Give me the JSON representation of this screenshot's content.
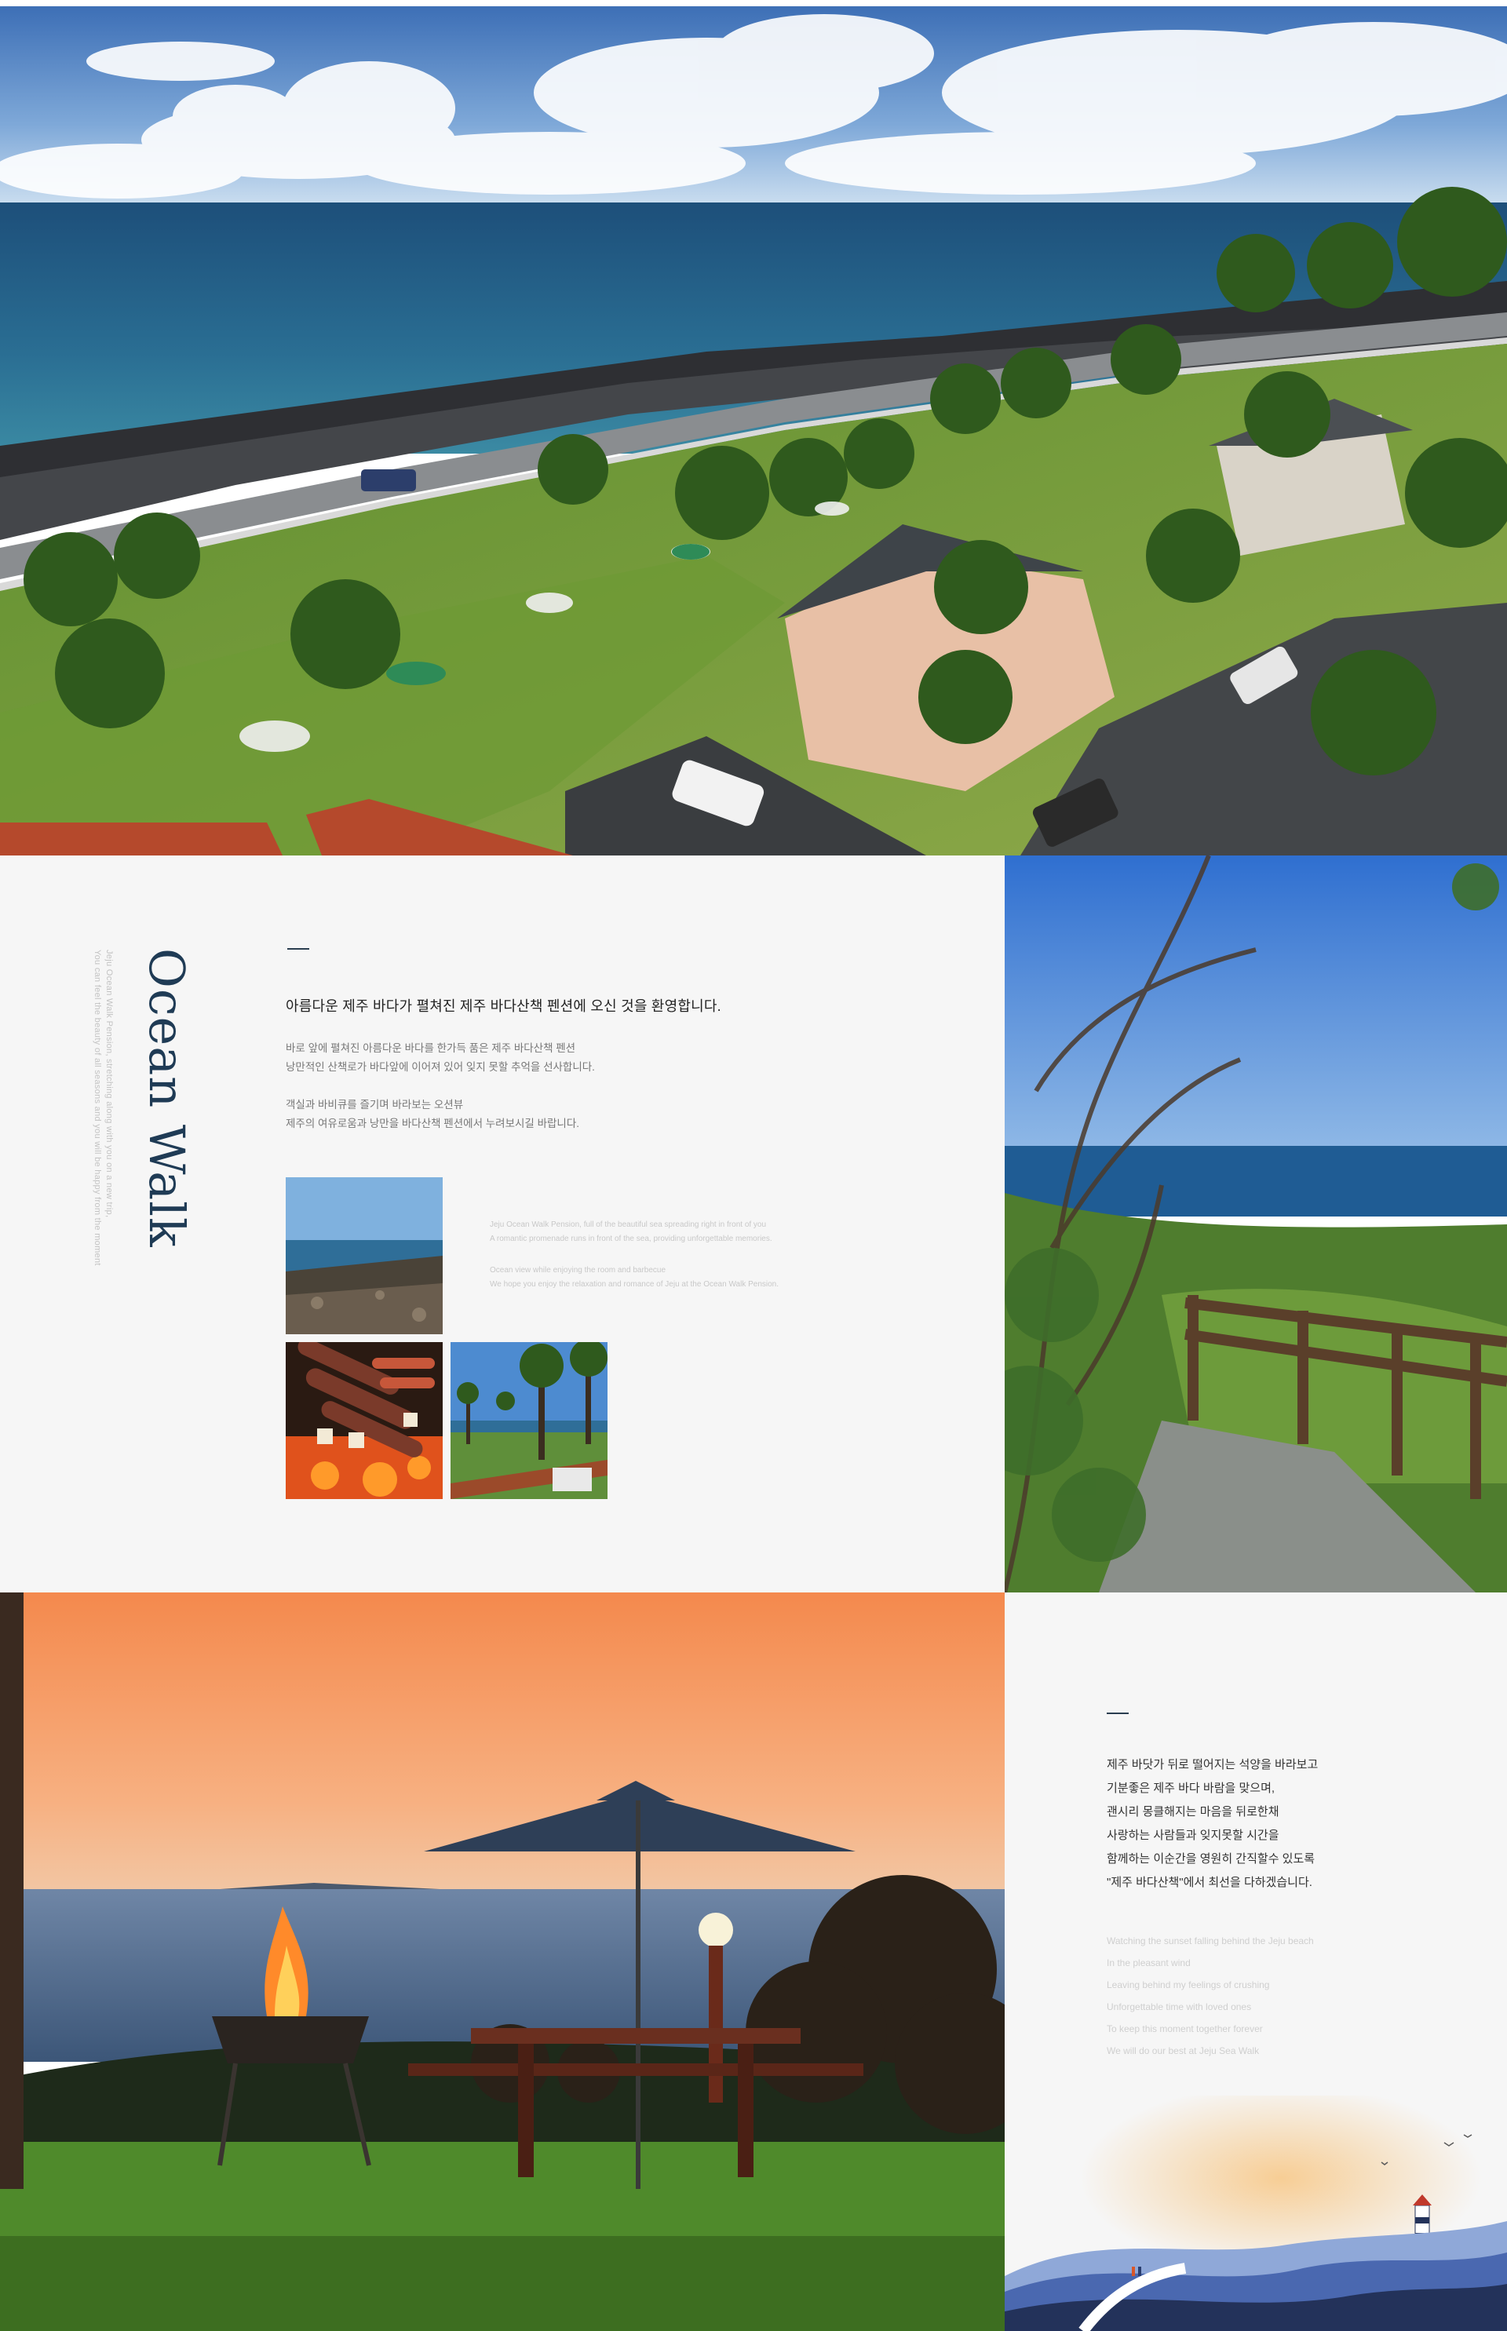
{
  "hero": {
    "image": "aerial coastal pension view"
  },
  "intro": {
    "vertical_title": "Ocean Walk",
    "vertical_subtitle": [
      "Jeju Ocean Walk Pension, stretching along with you on a new trip,",
      "You can feel the beauty of all seasons and you will be happy from the moment"
    ],
    "heading": "아름다운 제주 바다가 펼쳐진 제주 바다산책 펜션에 오신 것을 환영합니다.",
    "paragraph1": [
      "바로 앞에 펼쳐진 아름다운 바다를 한가득 품은 제주 바다산책 펜션",
      "낭만적인 산책로가 바다앞에 이어져 있어 잊지 못할 추억을 선사합니다."
    ],
    "paragraph2": [
      "객실과 바비큐를 즐기며 바라보는 오션뷰",
      "제주의 여유로움과 낭만을 바다산책 펜션에서 누려보시길 바랍니다."
    ],
    "english_note1": [
      "Jeju Ocean Walk Pension, full of the beautiful sea spreading right in front of you",
      "A romantic promenade runs in front of the sea, providing unforgettable memories."
    ],
    "english_note2": [
      "Ocean view while enjoying the room and barbecue",
      "We hope you enjoy the relaxation and romance of Jeju at the Ocean Walk Pension."
    ]
  },
  "message": {
    "korean_lines": [
      "제주 바닷가 뒤로 떨어지는 석양을 바라보고",
      "기분좋은 제주 바다 바람을 맞으며,",
      "괜시리 몽클해지는 마음을 뒤로한채",
      "사랑하는 사람들과 잊지못할 시간을",
      "함께하는 이순간을 영원히 간직할수 있도록",
      "\"제주 바다산책\"에서 최선을 다하겠습니다."
    ],
    "english_lines": [
      "Watching the sunset falling behind the Jeju beach",
      "In the pleasant wind",
      "Leaving behind my feelings of crushing",
      "Unforgettable time with loved ones",
      "To keep this moment together forever",
      "We will do our best at Jeju Sea Walk"
    ]
  },
  "colors": {
    "title_navy": "#1f3b55",
    "panel_bg": "#f6f6f6"
  }
}
